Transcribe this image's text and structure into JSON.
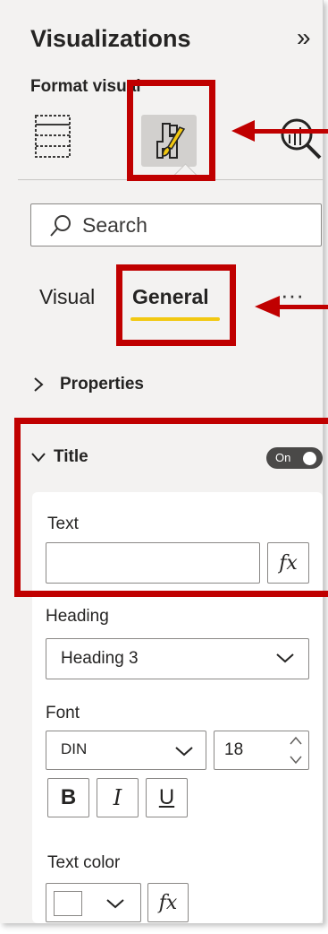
{
  "pane": {
    "title": "Visualizations",
    "subtitle": "Format visual",
    "collapse_glyph": "»"
  },
  "search": {
    "placeholder": "Search"
  },
  "tabs": {
    "visual": "Visual",
    "general": "General",
    "more": "···"
  },
  "sections": {
    "properties": "Properties",
    "title": "Title"
  },
  "title_section": {
    "toggle_label": "On",
    "text_label": "Text",
    "text_value": "",
    "fx": "fx",
    "heading_label": "Heading",
    "heading_value": "Heading 3",
    "font_label": "Font",
    "font_family": "DIN",
    "font_size": "18",
    "bold": "B",
    "italic": "I",
    "underline": "U",
    "text_color_label": "Text color"
  },
  "icons": {
    "build": "build-visual-icon",
    "format": "format-paintbrush-icon",
    "analytics": "analytics-magnifier-icon",
    "search": "search-icon"
  },
  "colors": {
    "annotation_red": "#c00000",
    "accent_yellow": "#f2c811",
    "toggle_dark": "#4a4948",
    "pane_background": "#f3f2f1"
  }
}
